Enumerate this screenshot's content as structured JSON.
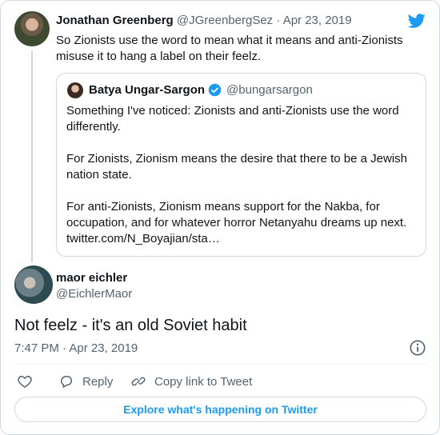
{
  "parent": {
    "name": "Jonathan Greenberg",
    "handle": "@JGreenbergSez",
    "separator": "·",
    "date": "Apr 23, 2019",
    "text": "So Zionists use the word to mean what it means and anti-Zionists misuse it to hang a label on their feelz."
  },
  "quote": {
    "name": "Batya Ungar-Sargon",
    "handle": "@bungarsargon",
    "verified": true,
    "text": "Something I've noticed: Zionists and anti-Zionists use the word differently.\n\nFor Zionists, Zionism means the desire that there to be a Jewish nation state.\n\nFor anti-Zionists, Zionism means support for the Nakba, for occupation, and for whatever horror Netanyahu dreams up next. twitter.com/N_Boyajian/sta…"
  },
  "reply": {
    "name": "maor eichler",
    "handle": "@EichlerMaor",
    "text": "Not feelz - it's an old Soviet habit",
    "timestamp": "7:47 PM · Apr 23, 2019"
  },
  "actions": {
    "reply_label": "Reply",
    "copy_label": "Copy link to Tweet"
  },
  "explore_label": "Explore what's happening on Twitter",
  "colors": {
    "brand": "#1d9bf0",
    "text": "#0f1419",
    "muted": "#536471",
    "border": "#cfd9de"
  },
  "icons": [
    "twitter-bird-icon",
    "verified-badge-icon",
    "info-icon",
    "heart-icon",
    "reply-bubble-icon",
    "link-icon"
  ]
}
